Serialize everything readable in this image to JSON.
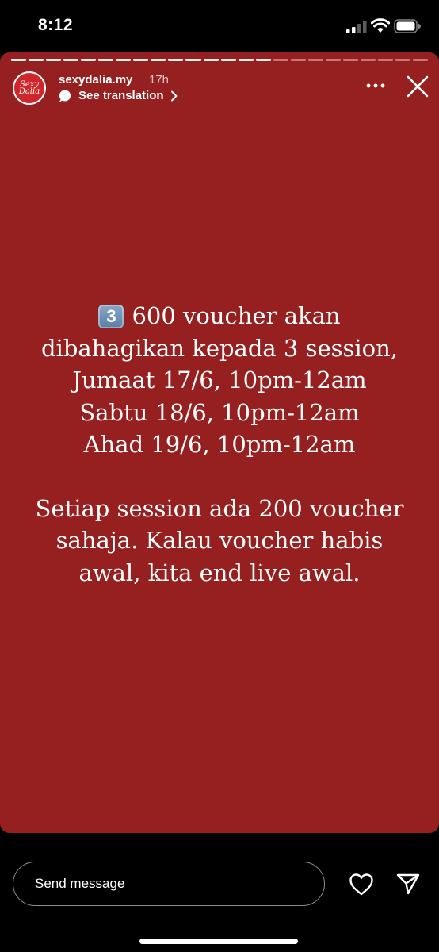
{
  "status_bar": {
    "time": "8:12",
    "icons": [
      "cellular-signal-icon",
      "wifi-icon",
      "battery-icon"
    ]
  },
  "story": {
    "background_color": "#96201f",
    "progress_total": 24,
    "progress_current": 15,
    "avatar_text_line1": "Sexy",
    "avatar_text_line2": "Dalia",
    "username": "sexydalia.my",
    "time_ago": "17h",
    "translation_label": "See translation",
    "keycap": "3",
    "text_block1": [
      "600 voucher akan",
      "dibahagikan kepada 3 session,",
      "Jumaat 17/6, 10pm-12am",
      "Sabtu 18/6, 10pm-12am",
      "Ahad 19/6, 10pm-12am"
    ],
    "text_block2": [
      "Setiap session ada 200 voucher",
      "sahaja. Kalau voucher habis",
      "awal, kita end live awal."
    ]
  },
  "bottom_bar": {
    "message_placeholder": "Send message",
    "icons": [
      "heart-icon",
      "send-icon"
    ]
  }
}
